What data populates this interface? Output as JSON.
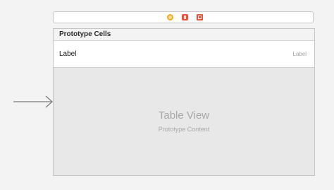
{
  "scene_dock": {
    "icons": [
      "view-controller-icon",
      "first-responder-icon",
      "exit-icon"
    ],
    "colors": {
      "view_controller": "#f2ad1f",
      "responder": "#e8553b",
      "exit": "#e8553b"
    }
  },
  "table": {
    "section_header": "Prototype Cells",
    "cell": {
      "title": "Label",
      "detail": "Label"
    },
    "placeholder_title": "Table View",
    "placeholder_subtitle": "Prototype Content"
  },
  "entry_point": {
    "icon": "entry-arrow-icon"
  }
}
